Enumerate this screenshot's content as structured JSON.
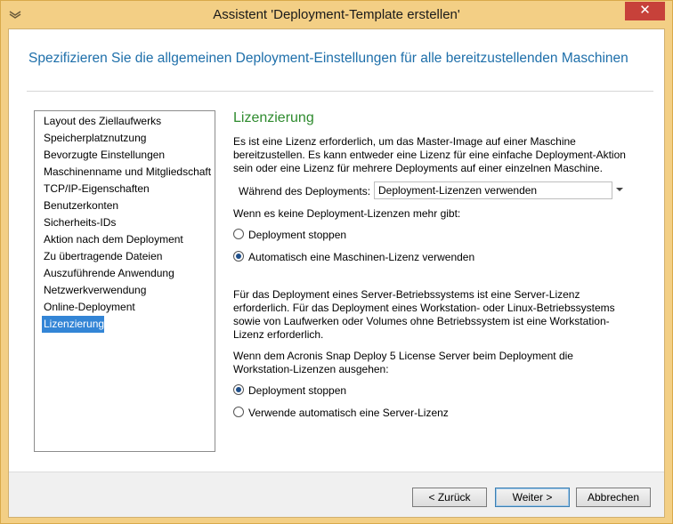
{
  "window": {
    "title": "Assistent 'Deployment-Template erstellen'",
    "close_symbol": "✕"
  },
  "header": {
    "text": "Spezifizieren Sie die allgemeinen Deployment-Einstellungen für alle bereitzustellenden Maschinen"
  },
  "nav": {
    "items": [
      "Layout des Ziellaufwerks",
      "Speicherplatznutzung",
      "Bevorzugte Einstellungen",
      "Maschinenname und Mitgliedschaft",
      "TCP/IP-Eigenschaften",
      "Benutzerkonten",
      "Sicherheits-IDs",
      "Aktion nach dem Deployment",
      "Zu übertragende Dateien",
      "Auszuführende Anwendung",
      "Netzwerkverwendung",
      "Online-Deployment",
      "Lizenzierung"
    ],
    "selected": "Lizenzierung"
  },
  "content": {
    "title": "Lizenzierung",
    "intro": "Es ist eine Lizenz erforderlich, um das Master-Image auf einer Maschine bereitzustellen. Es kann entweder eine Lizenz für eine einfache Deployment-Aktion sein oder eine Lizenz für mehrere Deployments auf einer einzelnen Maschine.",
    "during_label": "Während des Deployments:",
    "during_value": "Deployment-Lizenzen verwenden",
    "no_licenses_label": "Wenn es keine Deployment-Lizenzen mehr gibt:",
    "group1": [
      {
        "label": "Deployment stoppen",
        "checked": false
      },
      {
        "label": "Automatisch eine Maschinen-Lizenz verwenden",
        "checked": true
      }
    ],
    "server_info": "Für das Deployment eines Server-Betriebssystems ist eine Server-Lizenz erforderlich. Für das Deployment eines Workstation- oder Linux-Betriebssystems sowie von Laufwerken oder Volumes ohne Betriebssystem ist eine Workstation-Lizenz erforderlich.",
    "workstation_label": "Wenn dem Acronis Snap Deploy 5 License Server beim Deployment die Workstation-Lizenzen ausgehen:",
    "group2": [
      {
        "label": "Deployment stoppen",
        "checked": true
      },
      {
        "label": "Verwende automatisch eine Server-Lizenz",
        "checked": false
      }
    ]
  },
  "footer": {
    "back_label": "< Zurück",
    "next_label": "Weiter >",
    "cancel_label": "Abbrechen"
  },
  "colors": {
    "frame": "#f3cf85",
    "header_text": "#1e6faa",
    "section_title": "#2e8b2e",
    "selection": "#3385d6",
    "close_button": "#c7413a"
  }
}
